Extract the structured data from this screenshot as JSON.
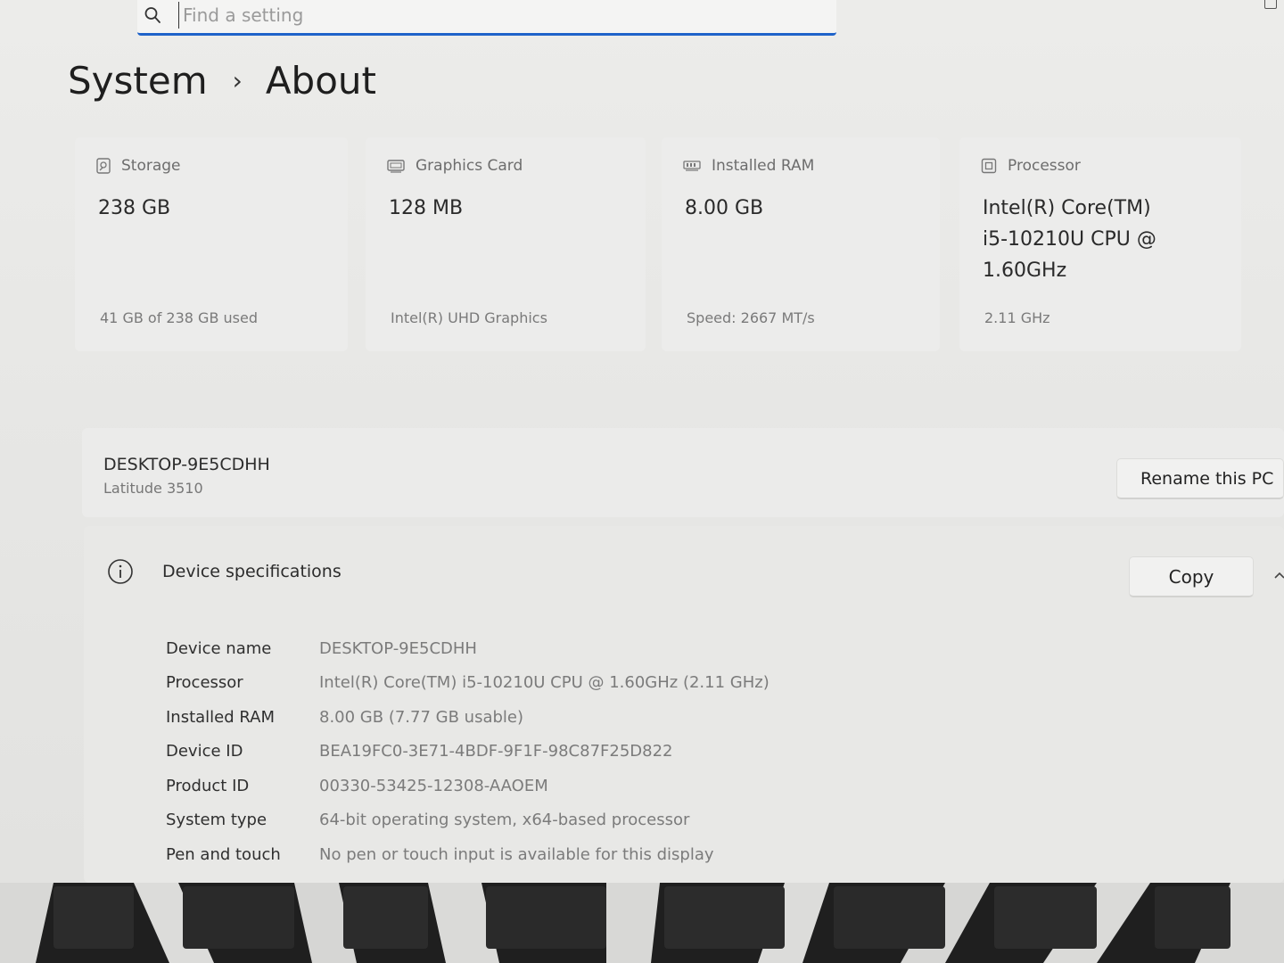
{
  "search": {
    "placeholder": "Find a setting"
  },
  "breadcrumb": {
    "parent": "System",
    "separator": "›",
    "current": "About"
  },
  "cards": [
    {
      "icon": "storage-icon",
      "label": "Storage",
      "value": "238 GB",
      "sub": "41 GB of 238 GB used"
    },
    {
      "icon": "graphics-card-icon",
      "label": "Graphics Card",
      "value": "128 MB",
      "sub": "Intel(R) UHD Graphics"
    },
    {
      "icon": "ram-icon",
      "label": "Installed RAM",
      "value": "8.00 GB",
      "sub": "Speed: 2667 MT/s"
    },
    {
      "icon": "processor-icon",
      "label": "Processor",
      "value_lines": [
        "Intel(R) Core(TM)",
        "i5-10210U CPU @",
        "1.60GHz"
      ],
      "sub": "2.11 GHz"
    }
  ],
  "device": {
    "name": "DESKTOP-9E5CDHH",
    "model": "Latitude 3510",
    "rename_label": "Rename this PC"
  },
  "specs": {
    "icon": "info-icon",
    "title": "Device specifications",
    "copy_label": "Copy",
    "rows": [
      {
        "key": "Device name",
        "value": "DESKTOP-9E5CDHH"
      },
      {
        "key": "Processor",
        "value": "Intel(R) Core(TM) i5-10210U CPU @ 1.60GHz (2.11 GHz)"
      },
      {
        "key": "Installed RAM",
        "value": "8.00 GB (7.77 GB usable)"
      },
      {
        "key": "Device ID",
        "value": "BEA19FC0-3E71-4BDF-9F1F-98C87F25D822"
      },
      {
        "key": "Product ID",
        "value": "00330-53425-12308-AAOEM"
      },
      {
        "key": "System type",
        "value": "64-bit operating system, x64-based processor"
      },
      {
        "key": "Pen and touch",
        "value": "No pen or touch input is available for this display"
      }
    ]
  },
  "colors": {
    "accent": "#1f63c9",
    "background": "#e9e9e7"
  }
}
